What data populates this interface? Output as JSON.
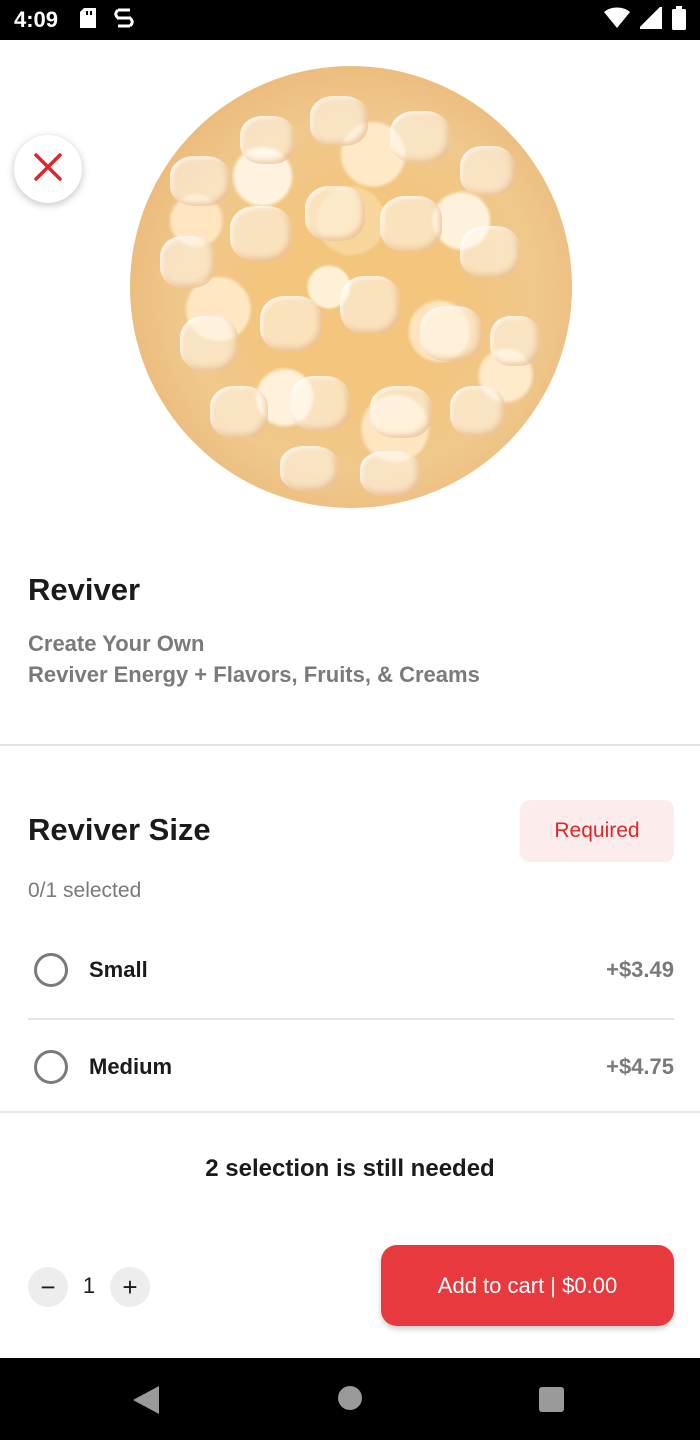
{
  "status_bar": {
    "time": "4:09",
    "icons": [
      "sd-card-icon",
      "app-notification-icon",
      "wifi-icon",
      "cell-signal-icon",
      "battery-icon"
    ]
  },
  "hero": {
    "image": "iced-reviver-drink-photo",
    "close_icon": "close-icon"
  },
  "product": {
    "title": "Reviver",
    "subtitle_line1": "Create Your Own",
    "subtitle_line2": "Reviver Energy + Flavors, Fruits, & Creams"
  },
  "size_section": {
    "title": "Reviver Size",
    "badge": "Required",
    "selected_count": "0/1 selected",
    "options": [
      {
        "label": "Small",
        "price": "+$3.49"
      },
      {
        "label": "Medium",
        "price": "+$4.75"
      }
    ]
  },
  "footer": {
    "needed_text": "2 selection is still needed",
    "quantity": "1",
    "decrement_label": "−",
    "increment_label": "+",
    "cart_button": "Add to cart | $0.00"
  },
  "colors": {
    "accent": "#e8393f",
    "required_text": "#e0262a",
    "required_bg": "#fdecec",
    "muted_text": "#7a7a7a"
  }
}
